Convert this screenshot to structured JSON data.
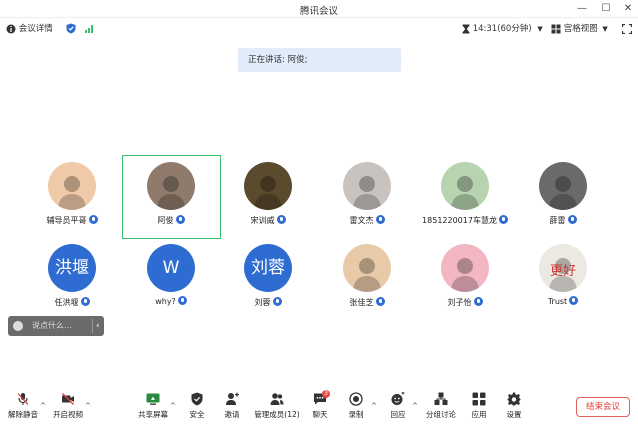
{
  "window": {
    "title": "腾讯会议",
    "min": "—",
    "max": "☐",
    "close": "✕"
  },
  "infobar": {
    "details_label": "会议详情",
    "timer": "14:31(60分钟)",
    "view_label": "宫格视图"
  },
  "speaking": {
    "text": "正在讲话: 阿俊;"
  },
  "participants": [
    {
      "name": "辅导员平哥",
      "avatar_type": "photo",
      "avatar_text": "",
      "photo_color": "#f0c9a8"
    },
    {
      "name": "阿俊",
      "avatar_type": "photo",
      "avatar_text": "",
      "photo_color": "#8f7a6b"
    },
    {
      "name": "宋训威",
      "avatar_type": "photo",
      "avatar_text": "",
      "photo_color": "#5a4a2e"
    },
    {
      "name": "雷文杰",
      "avatar_type": "photo",
      "avatar_text": "",
      "photo_color": "#c9c3c0"
    },
    {
      "name": "1851220017车慧龙",
      "avatar_type": "photo",
      "avatar_text": "",
      "photo_color": "#b7d3b0"
    },
    {
      "name": "薛雷",
      "avatar_type": "photo",
      "avatar_text": "",
      "photo_color": "#6a6a6a"
    },
    {
      "name": "任洪堰",
      "avatar_type": "text",
      "avatar_text": "洪堰",
      "photo_color": ""
    },
    {
      "name": "why?",
      "avatar_type": "text",
      "avatar_text": "W",
      "photo_color": ""
    },
    {
      "name": "刘蓉",
      "avatar_type": "text",
      "avatar_text": "刘蓉",
      "photo_color": ""
    },
    {
      "name": "张佳芝",
      "avatar_type": "photo",
      "avatar_text": "",
      "photo_color": "#e8c9a8"
    },
    {
      "name": "刘子怡",
      "avatar_type": "photo",
      "avatar_text": "",
      "photo_color": "#f2b7c3"
    },
    {
      "name": "Trust",
      "avatar_type": "photo",
      "avatar_text": "更好",
      "photo_color": "#ece8e2"
    }
  ],
  "chat": {
    "placeholder": "说点什么...",
    "arrow": "‹"
  },
  "toolbar": {
    "unmute": "解除静音",
    "video": "开启视频",
    "share": "共享屏幕",
    "security": "安全",
    "invite": "邀请",
    "members": "管理成员(12)",
    "chat": "聊天",
    "chat_badge": "3",
    "record": "录制",
    "reaction": "回应",
    "breakout": "分组讨论",
    "apps": "应用",
    "settings": "设置",
    "end": "结束会议"
  },
  "colors": {
    "accent": "#2f6cd1",
    "selected_border": "#3bbf6a",
    "end_red": "#e0403a",
    "banner_bg": "#e1ecfb"
  },
  "icons": [
    "info-icon",
    "shield-icon",
    "signal-icon",
    "hourglass-icon",
    "grid-icon",
    "fullscreen-icon",
    "mic-muted-icon",
    "camera-muted-icon",
    "share-screen-icon",
    "security-shield-icon",
    "invite-user-icon",
    "members-icon",
    "chat-icon",
    "record-icon",
    "reaction-icon",
    "breakout-icon",
    "apps-icon",
    "settings-gear-icon"
  ]
}
